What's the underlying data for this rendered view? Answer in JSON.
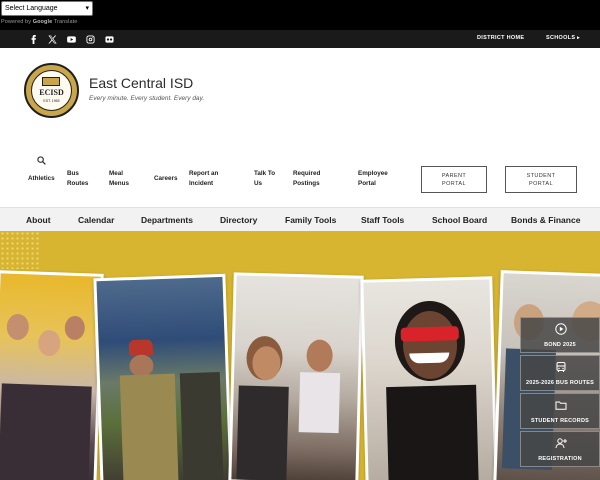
{
  "translate": {
    "select_label": "Select Language",
    "powered_by": "Powered by",
    "google": "Google",
    "translate": "Translate"
  },
  "utility": {
    "social": [
      "facebook-icon",
      "x-icon",
      "youtube-icon",
      "instagram-icon",
      "flickr-icon"
    ],
    "district_home": "DISTRICT HOME",
    "schools": "SCHOOLS"
  },
  "header": {
    "logo_text": "ECISD",
    "logo_est": "EST. 1965",
    "title": "East Central ISD",
    "tagline": "Every minute. Every student. Every day."
  },
  "secondary_nav": {
    "items": [
      {
        "line1": "Athletics",
        "line2": ""
      },
      {
        "line1": "Bus",
        "line2": "Routes"
      },
      {
        "line1": "Meal",
        "line2": "Menus"
      },
      {
        "line1": "Careers",
        "line2": ""
      },
      {
        "line1": "Report an",
        "line2": "Incident"
      },
      {
        "line1": "Talk To",
        "line2": "Us"
      },
      {
        "line1": "Required",
        "line2": "Postings"
      },
      {
        "line1": "Employee",
        "line2": "Portal"
      }
    ],
    "parent_portal": {
      "line1": "PARENT",
      "line2": "PORTAL"
    },
    "student_portal": {
      "line1": "STUDENT",
      "line2": "PORTAL"
    }
  },
  "main_nav": [
    "About",
    "Calendar",
    "Departments",
    "Directory",
    "Family Tools",
    "Staff Tools",
    "School Board",
    "Bonds & Finance"
  ],
  "quick_links": [
    "BOND 2025",
    "2025-2026 BUS ROUTES",
    "STUDENT RECORDS",
    "REGISTRATION"
  ],
  "colors": {
    "hero_bg": "#d8b530",
    "top_bar": "#000000",
    "util_bar": "#1a1a1a",
    "logo_gold": "#c9a64a"
  }
}
